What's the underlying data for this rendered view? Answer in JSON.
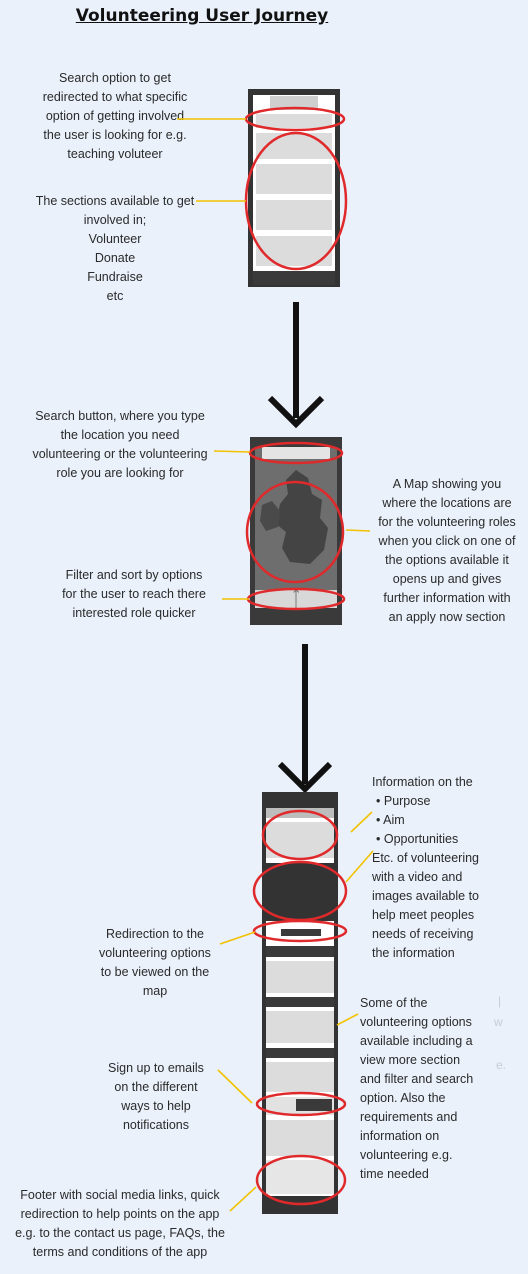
{
  "title": "Volunteering User Journey",
  "screen1": {
    "search_note": [
      "Search option to get",
      "redirected to what specific",
      "option of getting involved",
      "the user is looking for e.g.",
      "teaching voluteer"
    ],
    "sections_note": [
      "The sections available to get",
      "involved in;",
      "Volunteer",
      "Donate",
      "Fundraise",
      "etc"
    ]
  },
  "screen2": {
    "search_note": [
      "Search button, where you type",
      "the location you need",
      "volunteering or the volunteering",
      "role you are looking for"
    ],
    "map_note": [
      "A Map showing you",
      "where the locations are",
      "for the volunteering roles",
      "when you click on one of",
      "the options available it",
      "opens up and gives",
      "further information with",
      "an apply now section"
    ],
    "filter_note": [
      "Filter and sort by options",
      "for the user to reach there",
      "interested role quicker"
    ]
  },
  "screen3": {
    "info_note_heading": "Information on the",
    "info_bullets": [
      "Purpose",
      "Aim",
      "Opportunities"
    ],
    "info_note_rest": [
      "Etc. of volunteering",
      "with a video and",
      "images available to",
      "help meet peoples",
      "needs of receiving",
      "the information"
    ],
    "redirect_note": [
      "Redirection to the",
      "volunteering options",
      "to be viewed on the",
      "map"
    ],
    "options_note": [
      "Some of the",
      "volunteering options",
      "available  including a",
      "view more section",
      "and filter and search",
      "option. Also the",
      "requirements and",
      "information on",
      "volunteering e.g.",
      "time needed"
    ],
    "signup_note": [
      "Sign up to emails",
      "on the different",
      "ways to help",
      "notifications"
    ],
    "footer_note": [
      "Footer with social media links, quick",
      "redirection to help points on the app",
      "e.g. to the contact us page, FAQs, the",
      "terms and conditions of the app"
    ]
  },
  "colors": {
    "highlight_ring": "#e0292b",
    "leader_line": "#f2c200",
    "arrow": "#111111",
    "phone_frame": "#333333",
    "phone_block": "#dddddd"
  }
}
